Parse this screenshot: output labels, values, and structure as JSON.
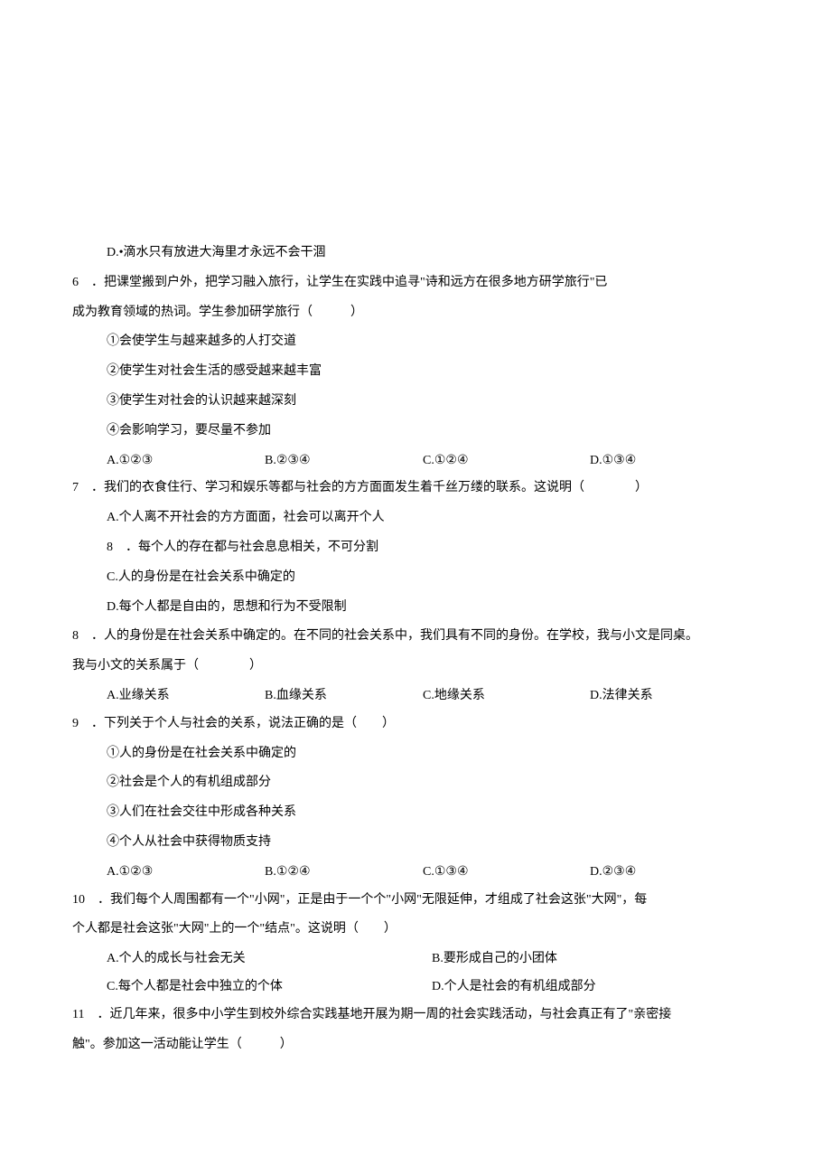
{
  "q5_optD": "D.•滴水只有放进大海里才永远不会干涸",
  "q6": {
    "num": "6",
    "stem1": "．把课堂搬到户外，把学习融入旅行，让学生在实践中追寻\"诗和远方在很多地方研学旅行\"已",
    "stem2": "成为教育领域的热词。学生参加研学旅行（　　　）",
    "o1": "①会使学生与越来越多的人打交道",
    "o2": "②使学生对社会生活的感受越来越丰富",
    "o3": "③使学生对社会的认识越来越深刻",
    "o4": "④会影响学习，要尽量不参加",
    "optA": "A.①②③",
    "optB": "B.②③④",
    "optC": "C.①②④",
    "optD": "D.①③④"
  },
  "q7": {
    "num": "7",
    "stem": "．我们的衣食住行、学习和娱乐等都与社会的方方面面发生着千丝万缕的联系。这说明（　　　　）",
    "optA": "A.个人离不开社会的方方面面，社会可以离开个人",
    "optB_num": "8",
    "optB": "．每个人的存在都与社会息息相关，不可分割",
    "optC": "C.人的身份是在社会关系中确定的",
    "optD": "D.每个人都是自由的，思想和行为不受限制"
  },
  "q8": {
    "num": "8",
    "stem1": "．人的身份是在社会关系中确定的。在不同的社会关系中，我们具有不同的身份。在学校，我与小文是同桌。",
    "stem2": "我与小文的关系属于（　　　　）",
    "optA": "A.业缘关系",
    "optB": "B.血缘关系",
    "optC": "C.地缘关系",
    "optD": "D.法律关系"
  },
  "q9": {
    "num": "9",
    "stem": "．下列关于个人与社会的关系，说法正确的是（　　）",
    "o1": "①人的身份是在社会关系中确定的",
    "o2": "②社会是个人的有机组成部分",
    "o3": "③人们在社会交往中形成各种关系",
    "o4": "④个人从社会中获得物质支持",
    "optA": "A.①②③",
    "optB": "B.①②④",
    "optC": "C.①③④",
    "optD": "D.②③④"
  },
  "q10": {
    "num": "10",
    "stem1": "．我们每个人周围都有一个\"小网\"，正是由于一个个\"小网\"无限延伸，才组成了社会这张\"大网\"，每",
    "stem2": "个人都是社会这张\"大网\"上的一个\"结点\"。这说明（　　）",
    "optA": "A.个人的成长与社会无关",
    "optB": "B.要形成自己的小团体",
    "optC": "C.每个人都是社会中独立的个体",
    "optD": "D.个人是社会的有机组成部分"
  },
  "q11": {
    "num": "11",
    "stem1": "．近几年来，很多中小学生到校外综合实践基地开展为期一周的社会实践活动，与社会真正有了\"亲密接",
    "stem2": "触\"。参加这一活动能让学生（　　　）"
  }
}
